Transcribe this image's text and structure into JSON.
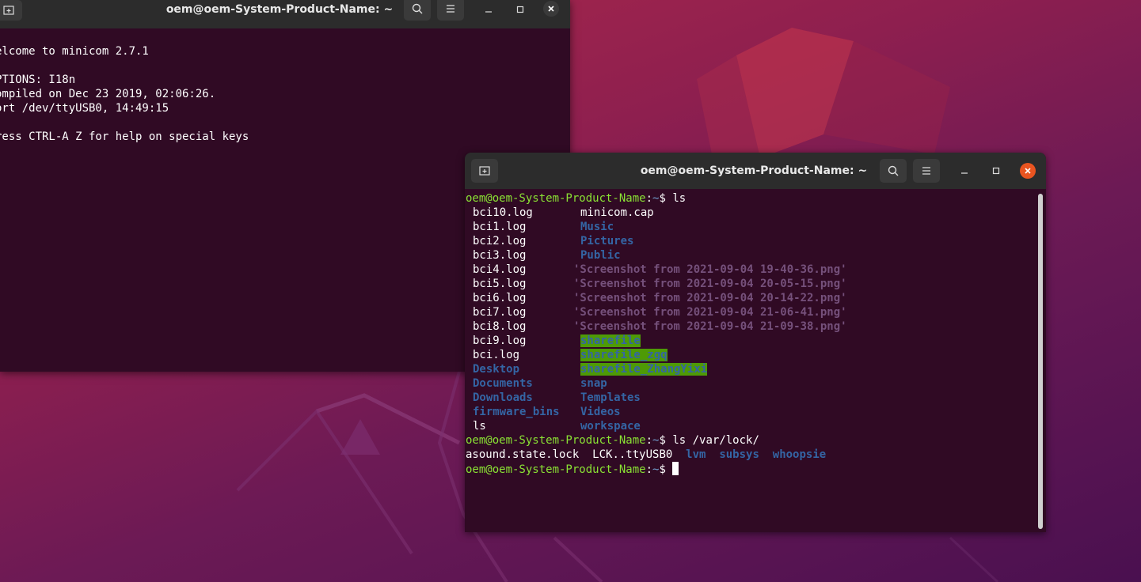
{
  "background": {
    "colors": [
      "#b02a4a",
      "#8e1f4f",
      "#6c1a55",
      "#4a1050"
    ]
  },
  "minicom_window": {
    "title": "oem@oem-System-Product-Name: ~",
    "lines": [
      "elcome to minicom 2.7.1",
      "",
      "PTIONS: I18n",
      "ompiled on Dec 23 2019, 02:06:26.",
      "ort /dev/ttyUSB0, 14:49:15",
      "",
      "ress CTRL-A Z for help on special keys"
    ]
  },
  "main_window": {
    "title": "oem@oem-System-Product-Name: ~",
    "prompt_user": "oem@oem-System-Product-Name",
    "prompt_sep": ":",
    "prompt_path": "~",
    "prompt_end": "$ ",
    "cmd1": "ls",
    "ls_col1": [
      {
        "name": "bci10.log",
        "type": "file"
      },
      {
        "name": "bci1.log",
        "type": "file"
      },
      {
        "name": "bci2.log",
        "type": "file"
      },
      {
        "name": "bci3.log",
        "type": "file"
      },
      {
        "name": "bci4.log",
        "type": "file"
      },
      {
        "name": "bci5.log",
        "type": "file"
      },
      {
        "name": "bci6.log",
        "type": "file"
      },
      {
        "name": "bci7.log",
        "type": "file"
      },
      {
        "name": "bci8.log",
        "type": "file"
      },
      {
        "name": "bci9.log",
        "type": "file"
      },
      {
        "name": "bci.log",
        "type": "file"
      },
      {
        "name": "Desktop",
        "type": "dir"
      },
      {
        "name": "Documents",
        "type": "dir"
      },
      {
        "name": "Downloads",
        "type": "dir"
      },
      {
        "name": "firmware_bins",
        "type": "dir"
      },
      {
        "name": "ls",
        "type": "file"
      }
    ],
    "ls_col2": [
      {
        "name": "minicom.cap",
        "type": "file"
      },
      {
        "name": "Music",
        "type": "dir"
      },
      {
        "name": "Pictures",
        "type": "dir"
      },
      {
        "name": "Public",
        "type": "dir"
      },
      {
        "name": "'Screenshot from 2021-09-04 19-40-36.png'",
        "type": "png"
      },
      {
        "name": "'Screenshot from 2021-09-04 20-05-15.png'",
        "type": "png"
      },
      {
        "name": "'Screenshot from 2021-09-04 20-14-22.png'",
        "type": "png"
      },
      {
        "name": "'Screenshot from 2021-09-04 21-06-41.png'",
        "type": "png"
      },
      {
        "name": "'Screenshot from 2021-09-04 21-09-38.png'",
        "type": "png"
      },
      {
        "name": "sharefile",
        "type": "shared"
      },
      {
        "name": "sharefile_zgq",
        "type": "shared"
      },
      {
        "name": "sharefile_ZhangYixi",
        "type": "shared"
      },
      {
        "name": "snap",
        "type": "dir"
      },
      {
        "name": "Templates",
        "type": "dir"
      },
      {
        "name": "Videos",
        "type": "dir"
      },
      {
        "name": "workspace",
        "type": "dir"
      }
    ],
    "cmd2": "ls /var/lock/",
    "lock_entries": [
      {
        "name": "asound.state.lock",
        "type": "file"
      },
      {
        "name": "LCK..ttyUSB0",
        "type": "file"
      },
      {
        "name": "lvm",
        "type": "dir"
      },
      {
        "name": "subsys",
        "type": "dir"
      },
      {
        "name": "whoopsie",
        "type": "dir"
      }
    ]
  },
  "colors": {
    "terminal_bg": "#300a24",
    "prompt_user": "#8ae234",
    "prompt_path": "#729fcf",
    "dir": "#3465a4",
    "png": "#75507b",
    "shared_bg": "#4e9a06",
    "close_button": "#e95420"
  },
  "icons": [
    "new-tab-icon",
    "search-icon",
    "hamburger-menu-icon",
    "minimize-icon",
    "maximize-icon",
    "close-icon"
  ]
}
